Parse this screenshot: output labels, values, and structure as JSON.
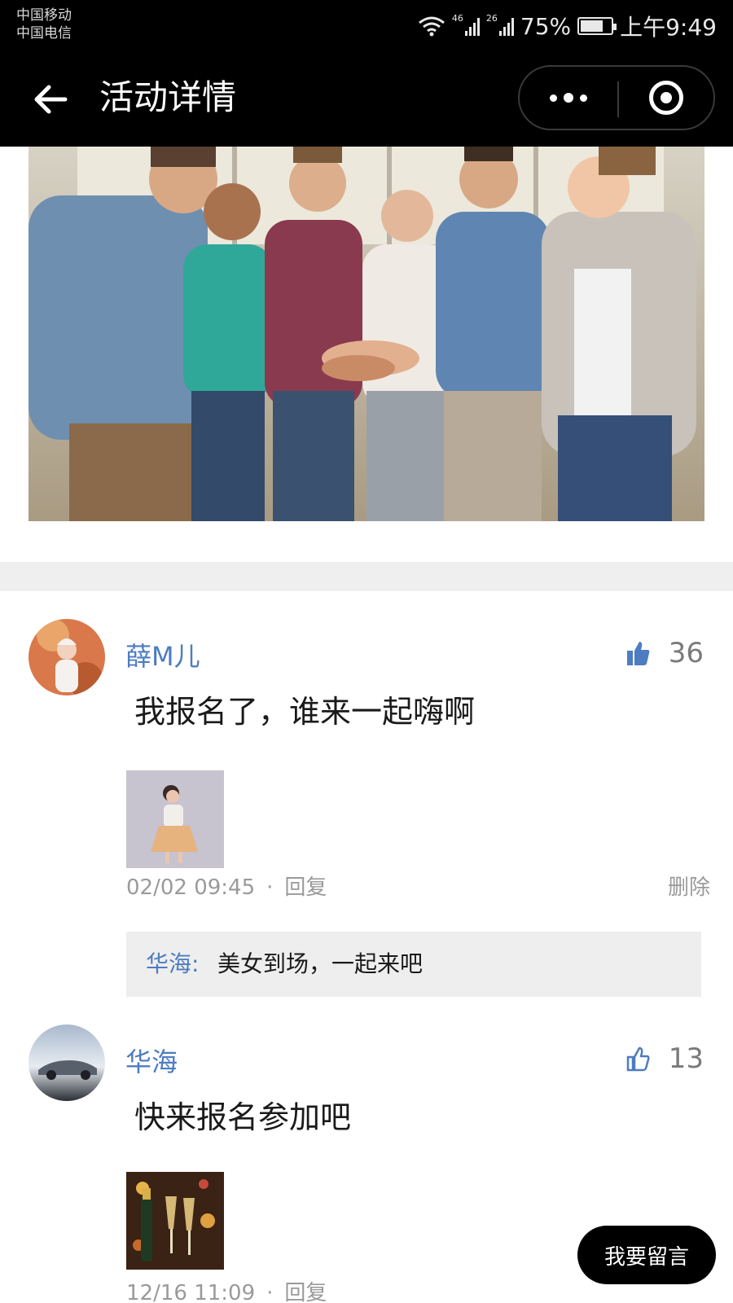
{
  "status_bar": {
    "carrier_1": "中国移动",
    "carrier_2": "中国电信",
    "signal_1_label": "46",
    "signal_2_label": "26",
    "battery": "75%",
    "battery_level": 0.75,
    "time": "上午9:49"
  },
  "nav": {
    "title": "活动详情",
    "back_icon": "arrow-left-icon",
    "more_icon": "more-dots-icon",
    "close_icon": "target-circle-icon"
  },
  "hero": {
    "description_icon": "team-hands-photo"
  },
  "comments": [
    {
      "user": "薛M儿",
      "likes": "36",
      "liked": true,
      "text": "我报名了，谁来一起嗨啊",
      "time": "02/02 09:45",
      "separator": "·",
      "reply_label": "回复",
      "delete_label": "删除",
      "replies": [
        {
          "name": "华海:",
          "text": "美女到场，一起来吧"
        }
      ]
    },
    {
      "user": "华海",
      "likes": "13",
      "liked": false,
      "text": "快来报名参加吧",
      "time": "12/16 11:09",
      "separator": "·",
      "reply_label": "回复"
    }
  ],
  "actions": {
    "leave_message": "我要留言"
  },
  "colors": {
    "accent_blue": "#4d7cc0",
    "nav_bg": "#000000",
    "muted_gray": "#9a9a9a"
  }
}
